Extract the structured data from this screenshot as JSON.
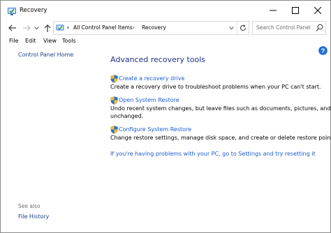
{
  "window": {
    "title": "Recovery"
  },
  "address": {
    "prefix": "«",
    "crumbs": [
      "All Control Panel Items",
      "Recovery"
    ],
    "separator": "›"
  },
  "search": {
    "placeholder": "Search Control Panel"
  },
  "menu": {
    "file": "File",
    "edit": "Edit",
    "view": "View",
    "tools": "Tools"
  },
  "sidebar": {
    "home": "Control Panel Home",
    "see_also": "See also",
    "links": [
      "File History"
    ]
  },
  "main": {
    "heading": "Advanced recovery tools",
    "tasks": [
      {
        "link": "Create a recovery drive",
        "description": [
          "Create a recovery drive to troubleshoot problems when your PC can't start."
        ]
      },
      {
        "link": "Open System Restore",
        "description": [
          "Undo recent system changes, but leave files such as documents, pictures, and music",
          "unchanged."
        ]
      },
      {
        "link": "Configure System Restore",
        "description": [
          "Change restore settings, manage disk space, and create or delete restore points."
        ]
      }
    ],
    "reset_link": "If you're having problems with your PC, go to Settings and try resetting it"
  },
  "colors": {
    "heading": "#1e3287",
    "link": "#1a5bcf",
    "nav_link": "#1a3e8a",
    "shield_blue": "#2a6fd6",
    "shield_yellow": "#f2c230"
  },
  "icons": {
    "app": "recovery-icon",
    "back": "back-arrow-icon",
    "forward": "forward-arrow-icon",
    "up": "up-arrow-icon",
    "refresh": "refresh-icon",
    "search": "search-icon",
    "help": "help-icon",
    "task": "shield-icon"
  }
}
